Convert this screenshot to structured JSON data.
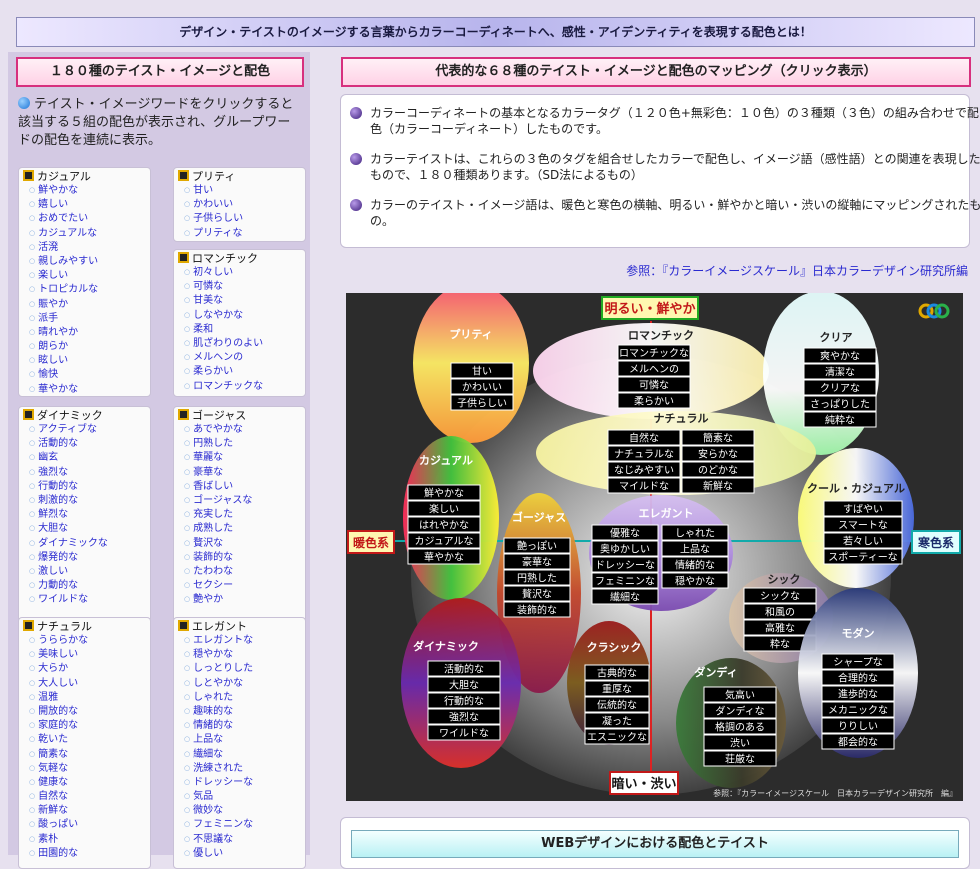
{
  "banner": "デザイン・テイストのイメージする言葉からカラーコーディネートへ、感性・アイデンティティを表現する配色とは！",
  "left_title": "１８０種のテイスト・イメージと配色",
  "left_intro": "テイスト・イメージワードをクリックすると該当する５組の配色が表示され、グループワードの配色を連続に表示。",
  "groups": [
    {
      "title": "カジュアル",
      "items": [
        "鮮やかな",
        "嬉しい",
        "おめでたい",
        "カジュアルな",
        "活溌",
        "親しみやすい",
        "楽しい",
        "トロピカルな",
        "賑やか",
        "派手",
        "晴れやか",
        "朗らか",
        "眩しい",
        "愉快",
        "華やかな"
      ]
    },
    {
      "title": "プリティ",
      "items": [
        "甘い",
        "かわいい",
        "子供らしい",
        "プリティな"
      ]
    },
    {
      "title": "ロマンチック",
      "items": [
        "初々しい",
        "可憐な",
        "甘美な",
        "しなやかな",
        "柔和",
        "肌ざわりのよい",
        "メルヘンの",
        "柔らかい",
        "ロマンチックな"
      ]
    },
    {
      "title": "ダイナミック",
      "items": [
        "アクティブな",
        "活動的な",
        "幽玄",
        "強烈な",
        "行動的な",
        "刺激的な",
        "鮮烈な",
        "大胆な",
        "ダイナミックな",
        "爆発的な",
        "激しい",
        "力動的な",
        "ワイルドな"
      ]
    },
    {
      "title": "ゴージャス",
      "items": [
        "あでやかな",
        "円熟した",
        "華麗な",
        "豪華な",
        "香ばしい",
        "ゴージャスな",
        "充実した",
        "成熟した",
        "贅沢な",
        "装飾的な",
        "たわわな",
        "セクシー",
        "艶やか"
      ]
    },
    {
      "title": "ナチュラル",
      "items": [
        "うららかな",
        "美味しい",
        "大らか",
        "大人しい",
        "温雅",
        "開放的な",
        "家庭的な",
        "乾いた",
        "簡素な",
        "気軽な",
        "健康な",
        "自然な",
        "新鮮な",
        "酸っぱい",
        "素朴",
        "田園的な"
      ]
    },
    {
      "title": "エレガント",
      "items": [
        "エレガントな",
        "穏やかな",
        "しっとりした",
        "しとやかな",
        "しゃれた",
        "趣味的な",
        "情緒的な",
        "上品な",
        "繊細な",
        "洗練された",
        "ドレッシーな",
        "気品",
        "微妙な",
        "フェミニンな",
        "不思議な",
        "優しい"
      ]
    }
  ],
  "right_title": "代表的な６８種のテイスト・イメージと配色のマッピング（クリック表示）",
  "bullets": [
    "カラーコーディネートの基本となるカラータグ（１２０色+無彩色：１０色）の３種類（３色）の組み合わせで配色（カラーコーディネート）したものです。",
    "カラーテイストは、これらの３色のタグを組合せしたカラーで配色し、イメージ語（感性語）との関連を表現したもので、１８０種類あります。（SD法によるもの）",
    "カラーのテイスト・イメージ語は、暖色と寒色の横軸、明るい・鮮やかと暗い・渋いの縦軸にマッピングされたもの。"
  ],
  "reference": "参照：『カラーイメージスケール』日本カラーデザイン研究所編",
  "map": {
    "axis_top": "明るい・鮮やか",
    "axis_bottom": "暗い・渋い",
    "axis_left": "暖色系",
    "axis_right": "寒色系",
    "credit": "参照：『カラーイメージスケール　日本カラーデザイン研究所　編』",
    "clusters": [
      {
        "name": "プリティ",
        "items": [
          "甘い",
          "かわいい",
          "子供らしい"
        ]
      },
      {
        "name": "ロマンチック",
        "items": [
          "ロマンチックな",
          "メルヘンの",
          "可憐な",
          "柔らかい"
        ]
      },
      {
        "name": "クリア",
        "items": [
          "爽やかな",
          "清潔な",
          "クリアな",
          "さっぱりした",
          "純粋な"
        ]
      },
      {
        "name": "ナチュラル",
        "items": [
          "自然な",
          "ナチュラルな",
          "なじみやすい",
          "マイルドな",
          "簡素な",
          "安らかな",
          "のどかな",
          "新鮮な"
        ]
      },
      {
        "name": "カジュアル",
        "items": [
          "鮮やかな",
          "楽しい",
          "はれやかな",
          "カジュアルな",
          "華やかな"
        ]
      },
      {
        "name": "クール・カジュアル",
        "items": [
          "すばやい",
          "スマートな",
          "若々しい",
          "スポーティーな"
        ]
      },
      {
        "name": "ゴージャス",
        "items": [
          "艶っぽい",
          "豪華な",
          "円熟した",
          "贅沢な",
          "装飾的な"
        ]
      },
      {
        "name": "エレガント",
        "items": [
          "優雅な",
          "奥ゆかしい",
          "ドレッシーな",
          "フェミニンな",
          "繊細な",
          "しゃれた",
          "上品な",
          "情緒的な",
          "穏やかな"
        ]
      },
      {
        "name": "シック",
        "items": [
          "シックな",
          "和風の",
          "高雅な",
          "粋な"
        ]
      },
      {
        "name": "ダイナミック",
        "items": [
          "活動的な",
          "大胆な",
          "行動的な",
          "強烈な",
          "ワイルドな"
        ]
      },
      {
        "name": "クラシック",
        "items": [
          "古典的な",
          "重厚な",
          "伝統的な",
          "凝った",
          "エスニックな"
        ]
      },
      {
        "name": "ダンディ",
        "items": [
          "気高い",
          "ダンディな",
          "格調のある",
          "渋い",
          "荘厳な"
        ]
      },
      {
        "name": "モダン",
        "items": [
          "シャープな",
          "合理的な",
          "進歩的な",
          "メカニックな",
          "りりしい",
          "都会的な"
        ]
      }
    ]
  },
  "bottom_title": "WEBデザインにおける配色とテイスト"
}
